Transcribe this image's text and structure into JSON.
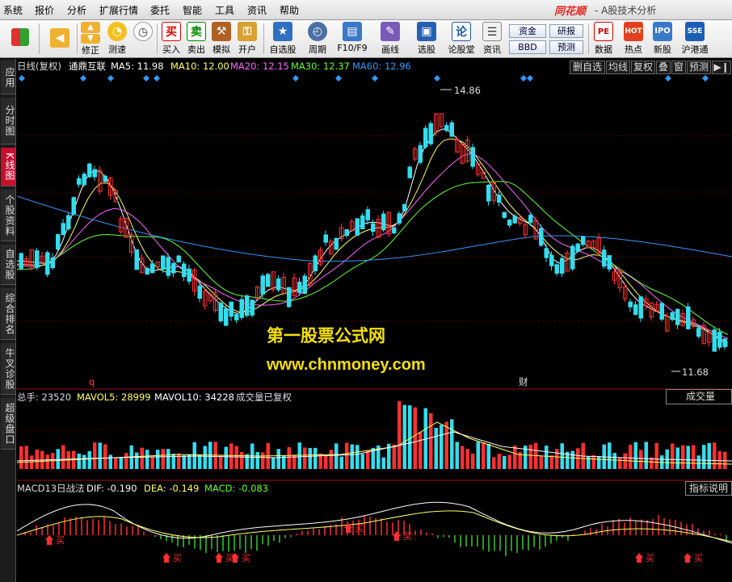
{
  "menu": {
    "items": [
      "系统",
      "报价",
      "分析",
      "扩展行情",
      "委托",
      "智能",
      "工具",
      "资讯",
      "帮助"
    ],
    "brand": "同花顺",
    "window_title": "- A股技术分析"
  },
  "toolbar": {
    "buttons": [
      "修正",
      "测速",
      "买入",
      "卖出",
      "模拟",
      "开户",
      "自选股",
      "周期",
      "F10/F9",
      "画线",
      "选股",
      "论股堂",
      "资讯",
      "数据",
      "热点",
      "新股",
      "沪港通"
    ],
    "small": {
      "zijin": "资金",
      "yanbao": "研报",
      "bbd": "BBD",
      "yuce": "预测"
    },
    "icons": [
      "windows-icon",
      "back-arrow-icon",
      "up-arrow-icon",
      "down-arrow-icon"
    ]
  },
  "sidebar": {
    "tabs": [
      "应用",
      "分时图",
      "K线图",
      "个股资料",
      "自选股",
      "综合排名",
      "牛叉诊股",
      "超级盘口"
    ]
  },
  "kline_panel": {
    "period": "日线(复权)",
    "stock": "通鼎互联",
    "ma5": "MA5: 11.98",
    "ma10": "MA10: 12.00",
    "ma20": "MA20: 12.15",
    "ma30": "MA30: 12.37",
    "ma60": "MA60: 12.96",
    "high_label": "14.86",
    "low_label": "11.68",
    "marker_q": "q",
    "marker_cai": "财",
    "buttons": [
      "删自选",
      "均线",
      "复权",
      "叠",
      "窗",
      "预测"
    ]
  },
  "volume_panel": {
    "total": "总手: 23520",
    "mavol5": "MAVOL5: 28999",
    "mavol10": "MAVOL10: 34228",
    "note": "成交量已复权",
    "select": "成交量"
  },
  "macd_panel": {
    "name": "MACD13日战法",
    "dif": "DIF: -0.190",
    "dea": "DEA: -0.149",
    "macd": "MACD: -0.083",
    "help": "指标说明",
    "buy_label": "买"
  },
  "watermark": {
    "line1": "第一股票公式网",
    "line2": "www.chnmoney.com"
  },
  "colors": {
    "up": "#ff3030",
    "down": "#33ddee",
    "ma5": "#ffffff",
    "ma10": "#ffff66",
    "ma20": "#ff66ff",
    "ma30": "#66ff33",
    "ma60": "#3399ff",
    "accent": "#c8102e"
  }
}
